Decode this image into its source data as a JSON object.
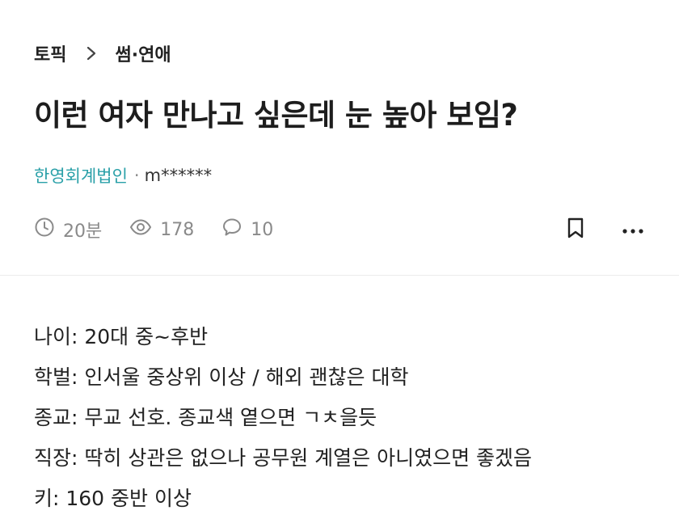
{
  "breadcrumb": {
    "parent": "토픽",
    "current": "썸·연애"
  },
  "post": {
    "title": "이런 여자 만나고 싶은데 눈 높아 보임?",
    "company": "한영회계법인",
    "separator": "·",
    "author": "m******",
    "stats": {
      "time": "20분",
      "views": "178",
      "comments": "10"
    }
  },
  "body": {
    "lines": [
      "나이: 20대 중~후반",
      "학벌: 인서울 중상위 이상 / 해외 괜찮은 대학",
      "종교: 무교 선호. 종교색 옅으면 ㄱㅊ을듯",
      "직장: 딱히 상관은 없으나 공무원 계열은 아니였으면 좋겠음",
      "키: 160 중반 이상"
    ]
  },
  "colors": {
    "company": "#2aa0a8",
    "muted": "#8a8a8a",
    "text": "#222222"
  },
  "icons": {
    "breadcrumb_sep": "chevron-right-icon",
    "time": "clock-icon",
    "views": "eye-icon",
    "comments": "speech-bubble-icon",
    "bookmark": "bookmark-icon",
    "more": "more-dots-icon"
  }
}
